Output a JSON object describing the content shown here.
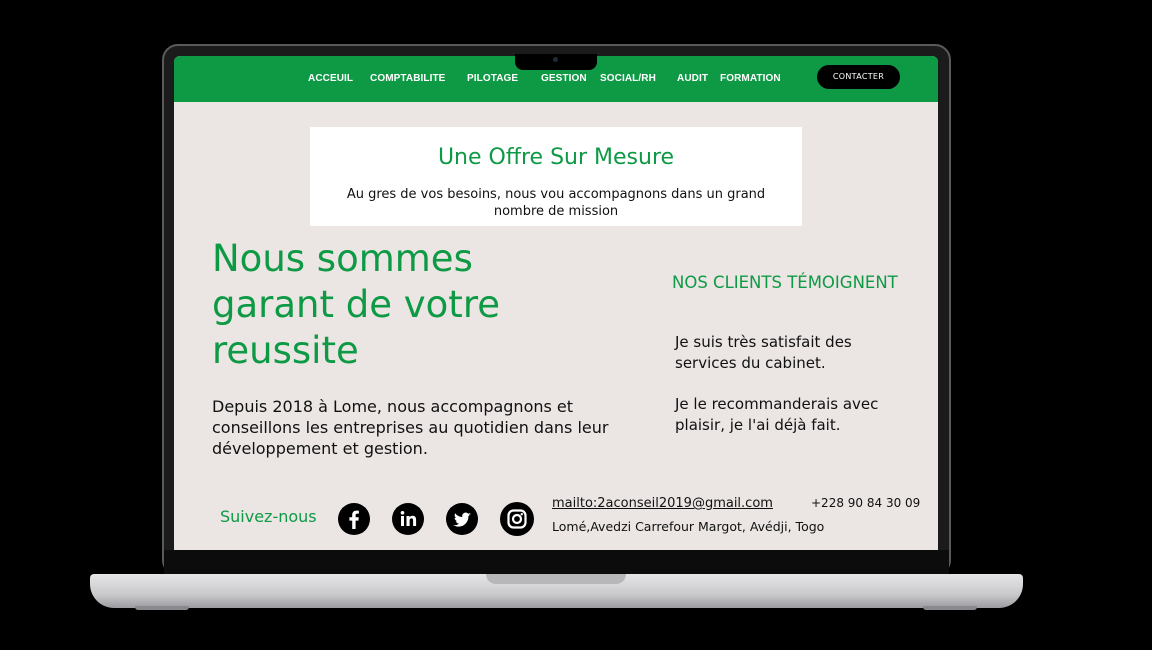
{
  "nav": {
    "items": [
      {
        "label": "ACCEUIL"
      },
      {
        "label": "COMPTABILITE"
      },
      {
        "label": "PILOTAGE"
      },
      {
        "label": "GESTION"
      },
      {
        "label": "SOCIAL/RH"
      },
      {
        "label": "AUDIT"
      },
      {
        "label": "FORMATION"
      }
    ],
    "contact_label": "CONTACTER"
  },
  "offer": {
    "title": "Une Offre Sur Mesure",
    "subtitle": "Au gres de vos besoins, nous vou accompagnons dans un grand nombre de mission"
  },
  "hero": {
    "title": "Nous sommes garant de votre reussite",
    "text": "Depuis 2018 à Lome, nous accompagnons et conseillons les entreprises au quotidien dans leur développement et gestion."
  },
  "testimonials": {
    "title": "NOS CLIENTS TÉMOIGNENT",
    "quotes": [
      "Je suis très satisfait des services du cabinet.",
      "Je le recommanderais avec plaisir, je l'ai déjà fait."
    ]
  },
  "footer": {
    "follow_label": "Suivez-nous",
    "social": [
      "facebook-icon",
      "linkedin-icon",
      "twitter-icon",
      "instagram-icon"
    ],
    "email": "mailto:2aconseil2019@gmail.com",
    "phone": "+228 90 84 30 09",
    "address": "Lomé,Avedzi Carrefour Margot, Avédji, Togo"
  },
  "colors": {
    "brand_green": "#0e9a45",
    "background": "#ebe5e4"
  }
}
